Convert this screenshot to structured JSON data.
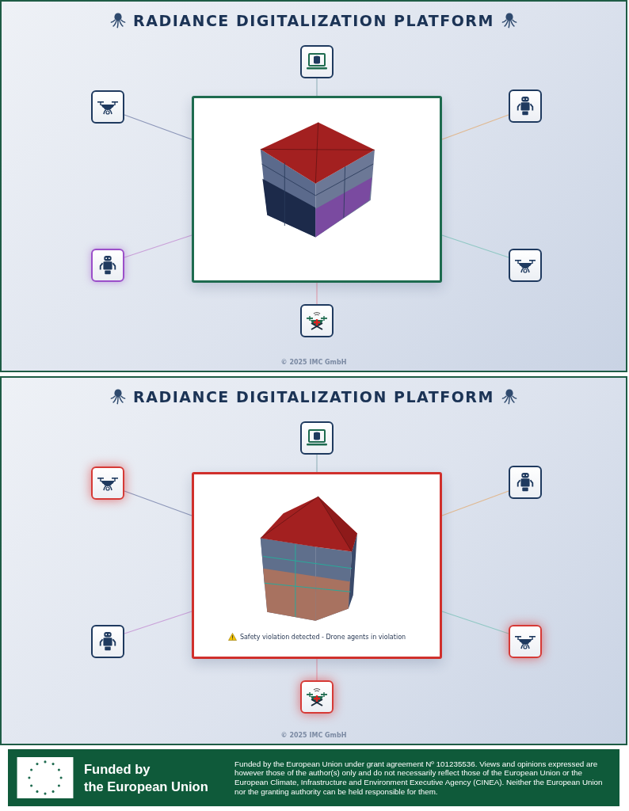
{
  "panels": [
    {
      "title": "RADIANCE DIGITALIZATION PLATFORM",
      "violation": false,
      "nodes": [
        {
          "kind": "laptop",
          "highlighted": false,
          "violation": false
        },
        {
          "kind": "drone",
          "highlighted": false,
          "violation": false
        },
        {
          "kind": "robot",
          "highlighted": false,
          "violation": false
        },
        {
          "kind": "robot",
          "highlighted": true,
          "violation": false
        },
        {
          "kind": "drone",
          "highlighted": false,
          "violation": false
        },
        {
          "kind": "medical_drone",
          "highlighted": false,
          "violation": false
        }
      ],
      "copyright": "© 2025 IMC GmbH"
    },
    {
      "title": "RADIANCE DIGITALIZATION PLATFORM",
      "violation": true,
      "nodes": [
        {
          "kind": "laptop",
          "highlighted": false,
          "violation": false
        },
        {
          "kind": "drone",
          "highlighted": false,
          "violation": true
        },
        {
          "kind": "robot",
          "highlighted": false,
          "violation": false
        },
        {
          "kind": "robot",
          "highlighted": false,
          "violation": false
        },
        {
          "kind": "drone",
          "highlighted": false,
          "violation": true
        },
        {
          "kind": "medical_drone",
          "highlighted": false,
          "violation": true
        }
      ],
      "warning": "Safety violation detected - Drone agents in violation",
      "copyright": "© 2025 IMC GmbH"
    }
  ],
  "footer": {
    "funded": [
      "Funded by",
      "the European Union"
    ],
    "disclaimer": "Funded by the European Union under grant agreement Nº 101235536. Views and opinions expressed are however those of the author(s) only and do not necessarily reflect those of the European Union or the European Climate, Infrastructure and Environment Executive Agency (CINEA). Neither the European Union nor the granting authority can be held responsible for them."
  }
}
